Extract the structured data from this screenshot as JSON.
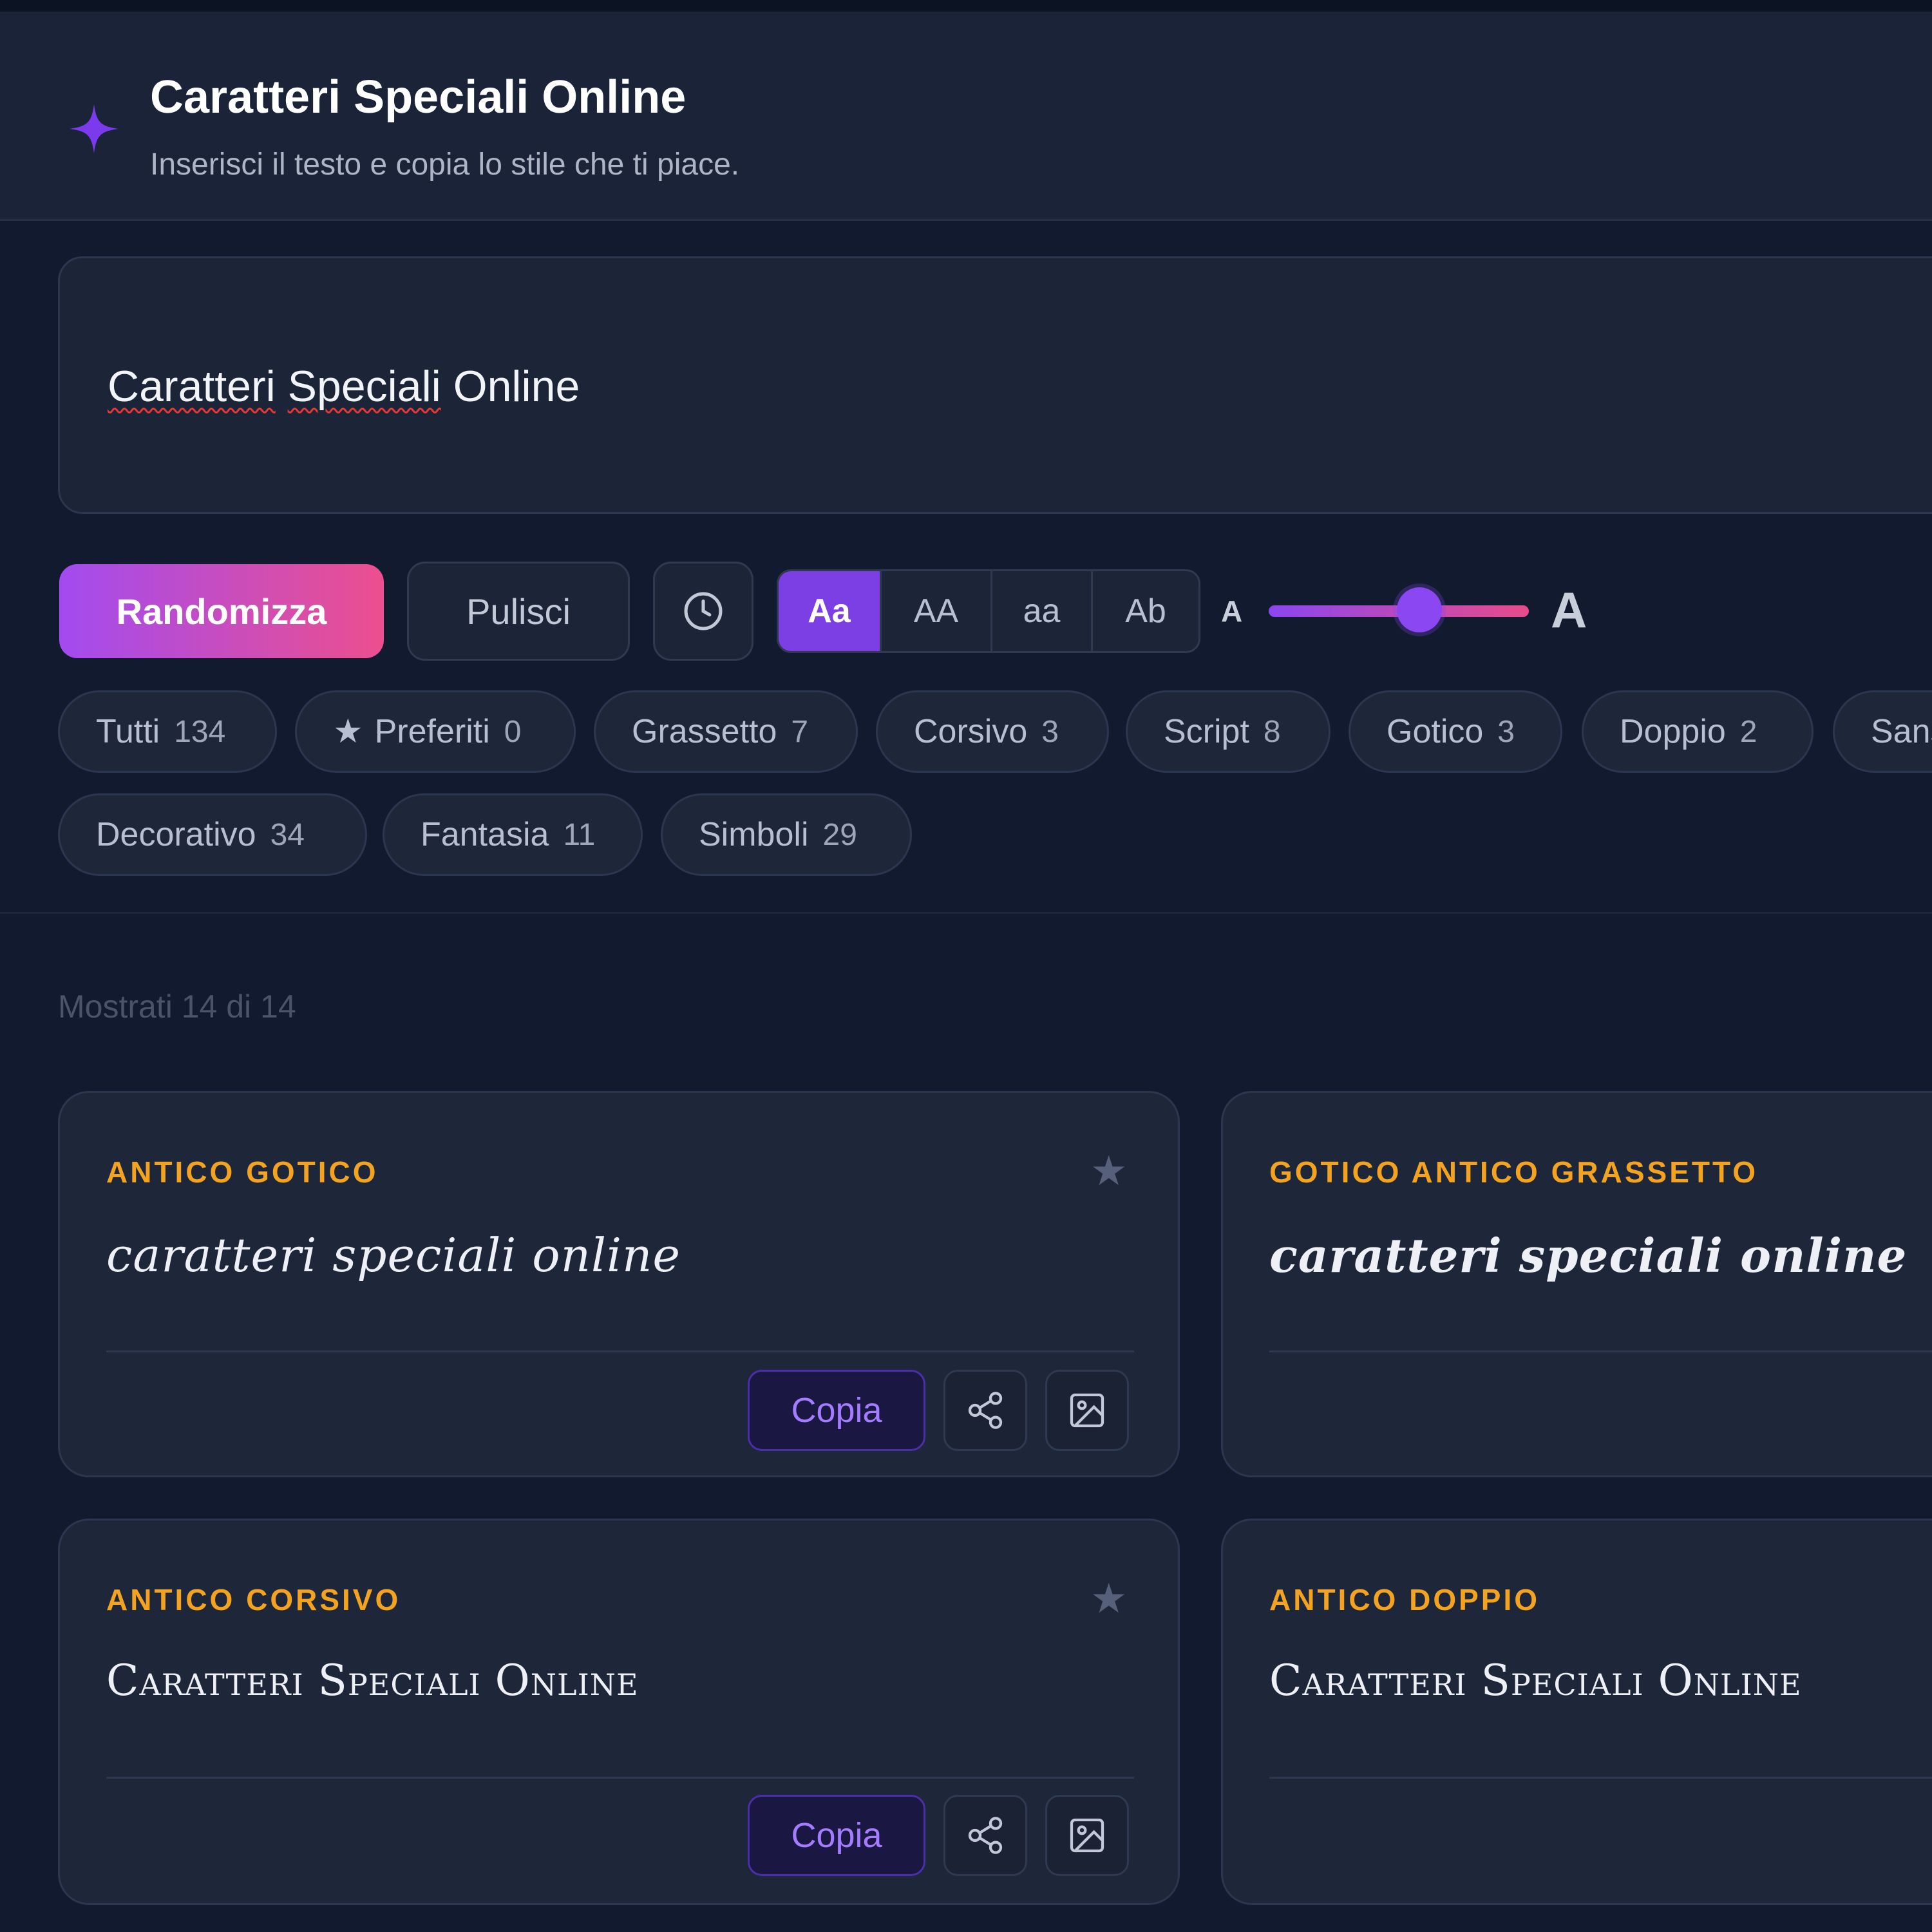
{
  "header": {
    "title": "Caratteri Speciali Online",
    "subtitle": "Inserisci il testo e copia lo stile che ti piace."
  },
  "input": {
    "text_part1": "Caratteri",
    "text_part2": "Speciali",
    "text_part3": "Online"
  },
  "toolbar": {
    "randomize_label": "Randomizza",
    "clear_label": "Pulisci",
    "history_icon": "clock-icon",
    "case_options": [
      {
        "label": "Aa",
        "active": true
      },
      {
        "label": "AA",
        "active": false
      },
      {
        "label": "aa",
        "active": false
      },
      {
        "label": "Ab",
        "active": false
      }
    ],
    "size_small_label": "A",
    "size_large_label": "A",
    "size_slider_level": 0.58
  },
  "filters": [
    {
      "label": "Tutti",
      "count": "134"
    },
    {
      "label": "Preferiti",
      "count": "0",
      "icon": "star-icon"
    },
    {
      "label": "Grassetto",
      "count": "7"
    },
    {
      "label": "Corsivo",
      "count": "3"
    },
    {
      "label": "Script",
      "count": "8"
    },
    {
      "label": "Gotico",
      "count": "3"
    },
    {
      "label": "Doppio",
      "count": "2"
    },
    {
      "label": "Sans",
      "count": ""
    },
    {
      "label": "Decorativo",
      "count": "34"
    },
    {
      "label": "Fantasia",
      "count": "11"
    },
    {
      "label": "Simboli",
      "count": "29"
    }
  ],
  "results": {
    "shown_text": "Mostrati 14 di 14"
  },
  "cards": [
    {
      "label": "ANTICO GOTICO",
      "preview": "caratteri speciali online"
    },
    {
      "label": "GOTICO ANTICO GRASSETTO",
      "preview": "caratteri speciali online"
    },
    {
      "label": "ANTICO CORSIVO",
      "preview": "Caratteri Speciali Online"
    },
    {
      "label": "ANTICO DOPPIO",
      "preview": "Caratteri Speciali Online"
    }
  ],
  "card_actions": {
    "copy_label": "Copia",
    "share_icon": "share-icon",
    "image_icon": "image-icon"
  },
  "colors": {
    "accent_purple": "#7b3fe4",
    "accent_pink": "#ec4f8e",
    "label_orange": "#f4a320",
    "background": "#111a2e"
  }
}
